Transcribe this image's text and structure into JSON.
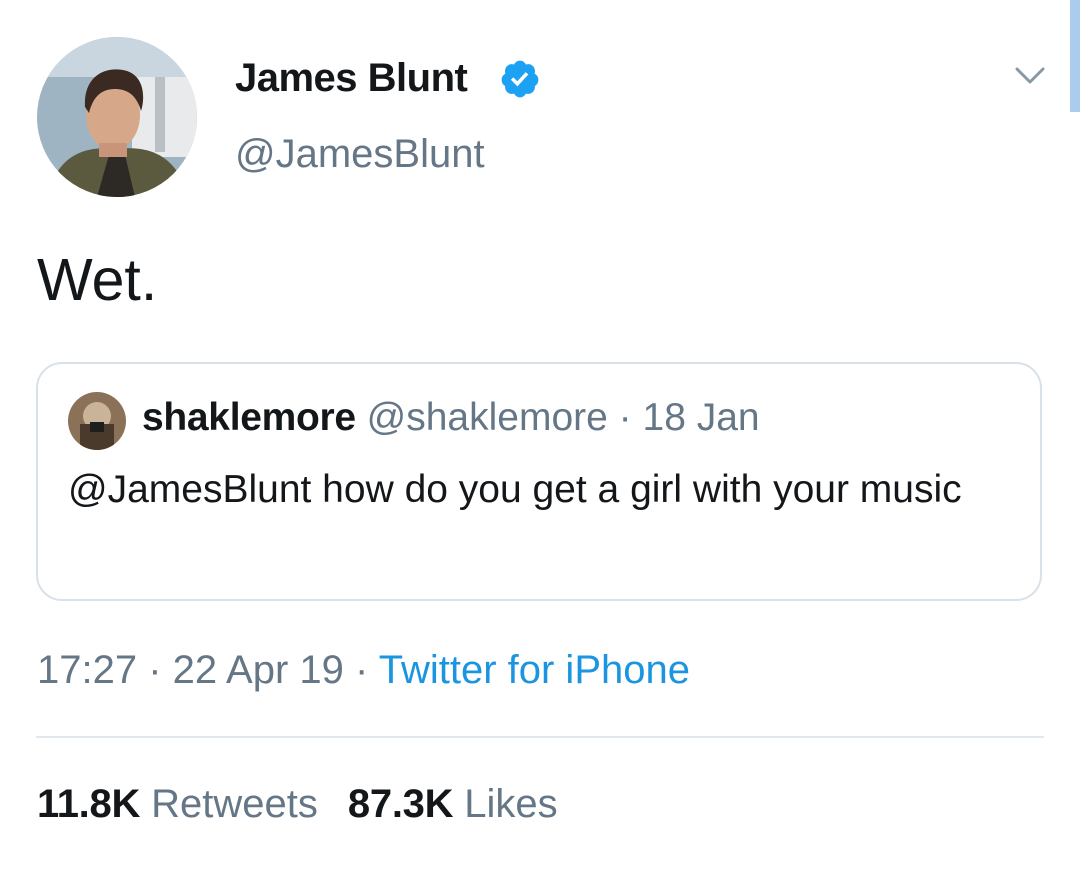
{
  "tweet": {
    "author": {
      "display_name": "James Blunt",
      "handle": "@JamesBlunt",
      "verified": true
    },
    "text": "Wet.",
    "quoted": {
      "display_name": "shaklemore",
      "handle": "@shaklemore",
      "separator": "·",
      "date": "18 Jan",
      "text": "@JamesBlunt how do you get a girl with your music"
    },
    "meta": {
      "time": "17:27",
      "separator1": " · ",
      "date": "22 Apr 19",
      "separator2": " · ",
      "source": "Twitter for iPhone"
    },
    "stats": {
      "retweets_count": "11.8K",
      "retweets_label": "Retweets",
      "likes_count": "87.3K",
      "likes_label": "Likes"
    }
  },
  "colors": {
    "verified": "#1da1f2",
    "link": "#1b95e0",
    "secondary_text": "#657786",
    "divider": "#e1e8ed"
  },
  "icons": {
    "verified": "verified-badge-icon",
    "caret": "chevron-down-icon"
  }
}
